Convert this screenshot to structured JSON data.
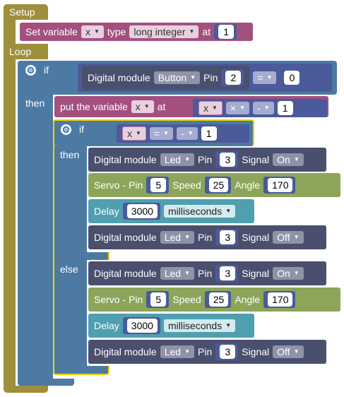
{
  "setup": {
    "label": "Setup",
    "set_block": {
      "prefix": "Set variable",
      "var": "x",
      "type_label": "type",
      "type_value": "long integer",
      "at_label": "at",
      "value": "1"
    }
  },
  "loop": {
    "label": "Loop",
    "if_outer": {
      "if_label": "if",
      "then_label": "then",
      "condition": {
        "module_label": "Digital module",
        "module_value": "Button",
        "pin_label": "Pin",
        "pin": "2",
        "op": "=",
        "compare": "0"
      },
      "put_block": {
        "label": "put the variable",
        "var": "x",
        "at_label": "at",
        "expr_var": "x",
        "expr_op": "×",
        "neg_op": "-",
        "neg_value": "1"
      },
      "if_inner": {
        "if_label": "if",
        "then_label": "then",
        "else_label": "else",
        "condition": {
          "var": "x",
          "op": "=",
          "neg_op": "-",
          "value": "1"
        },
        "then_blocks": {
          "led_on": {
            "label": "Digital module",
            "module": "Led",
            "pin_label": "Pin",
            "pin": "3",
            "signal_label": "Signal",
            "signal": "On"
          },
          "servo": {
            "label": "Servo - Pin",
            "pin": "5",
            "speed_label": "Speed",
            "speed": "25",
            "angle_label": "Angle",
            "angle": "170"
          },
          "delay": {
            "label": "Delay",
            "value": "3000",
            "unit": "milliseconds"
          },
          "led_off": {
            "label": "Digital module",
            "module": "Led",
            "pin_label": "Pin",
            "pin": "3",
            "signal_label": "Signal",
            "signal": "Off"
          }
        },
        "else_blocks": {
          "led_on": {
            "label": "Digital module",
            "module": "Led",
            "pin_label": "Pin",
            "pin": "3",
            "signal_label": "Signal",
            "signal": "On"
          },
          "servo": {
            "label": "Servo - Pin",
            "pin": "5",
            "speed_label": "Speed",
            "speed": "25",
            "angle_label": "Angle",
            "angle": "170"
          },
          "delay": {
            "label": "Delay",
            "value": "3000",
            "unit": "milliseconds"
          },
          "led_off": {
            "label": "Digital module",
            "module": "Led",
            "pin_label": "Pin",
            "pin": "3",
            "signal_label": "Signal",
            "signal": "Off"
          }
        }
      }
    }
  },
  "colors": {
    "event": "#9e8f3c",
    "control": "#4d7aa3",
    "variable": "#a3507e",
    "math": "#4a5a9a",
    "module": "#4a4f6e",
    "servo": "#8ca55a",
    "delay": "#4f9fb0",
    "selected": "#f2d200"
  }
}
